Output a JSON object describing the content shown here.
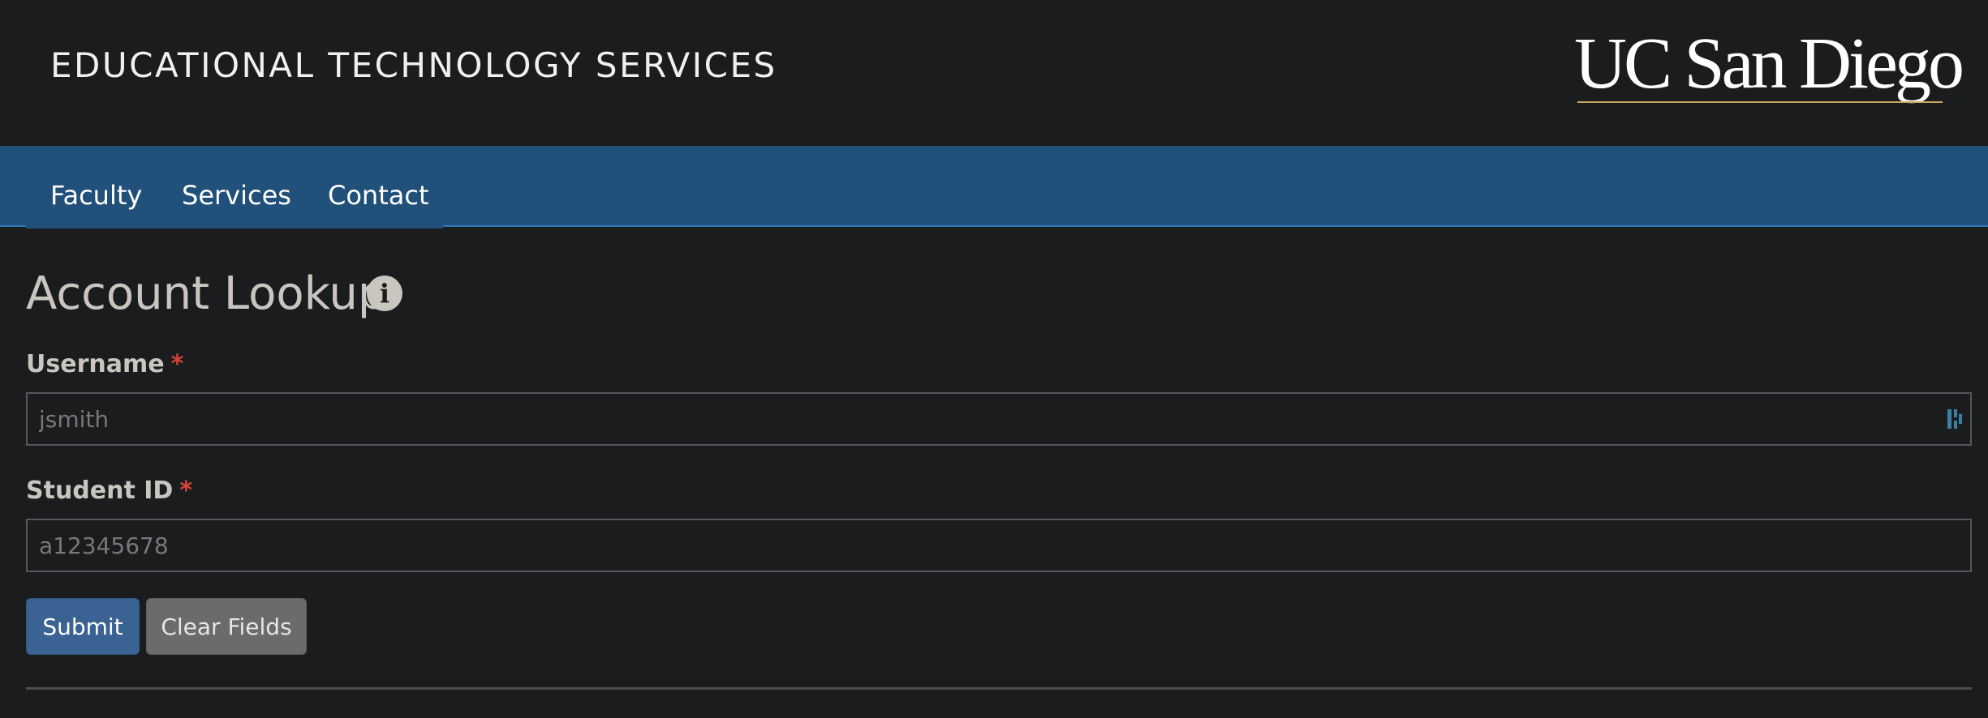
{
  "header": {
    "site_title": "EDUCATIONAL TECHNOLOGY SERVICES",
    "logo_text": "UC San Diego"
  },
  "nav": {
    "items": [
      {
        "label": "Faculty"
      },
      {
        "label": "Services"
      },
      {
        "label": "Contact"
      }
    ]
  },
  "main": {
    "title": "Account Lookup",
    "info_icon": "i",
    "fields": {
      "username": {
        "label": "Username",
        "required_marker": "*",
        "value": "",
        "placeholder": "jsmith"
      },
      "student_id": {
        "label": "Student ID",
        "required_marker": "*",
        "value": "",
        "placeholder": "a12345678"
      }
    },
    "buttons": {
      "submit": "Submit",
      "clear": "Clear Fields"
    }
  },
  "icons": {
    "info": "info-circle-icon",
    "password_manager": "password-manager-icon"
  },
  "colors": {
    "background": "#1b1c1e",
    "nav_background": "#21507b",
    "submit_button": "#3a6293",
    "clear_button": "#6b6b6b",
    "required": "#d9433b",
    "logo_rule": "#c9a75a"
  }
}
